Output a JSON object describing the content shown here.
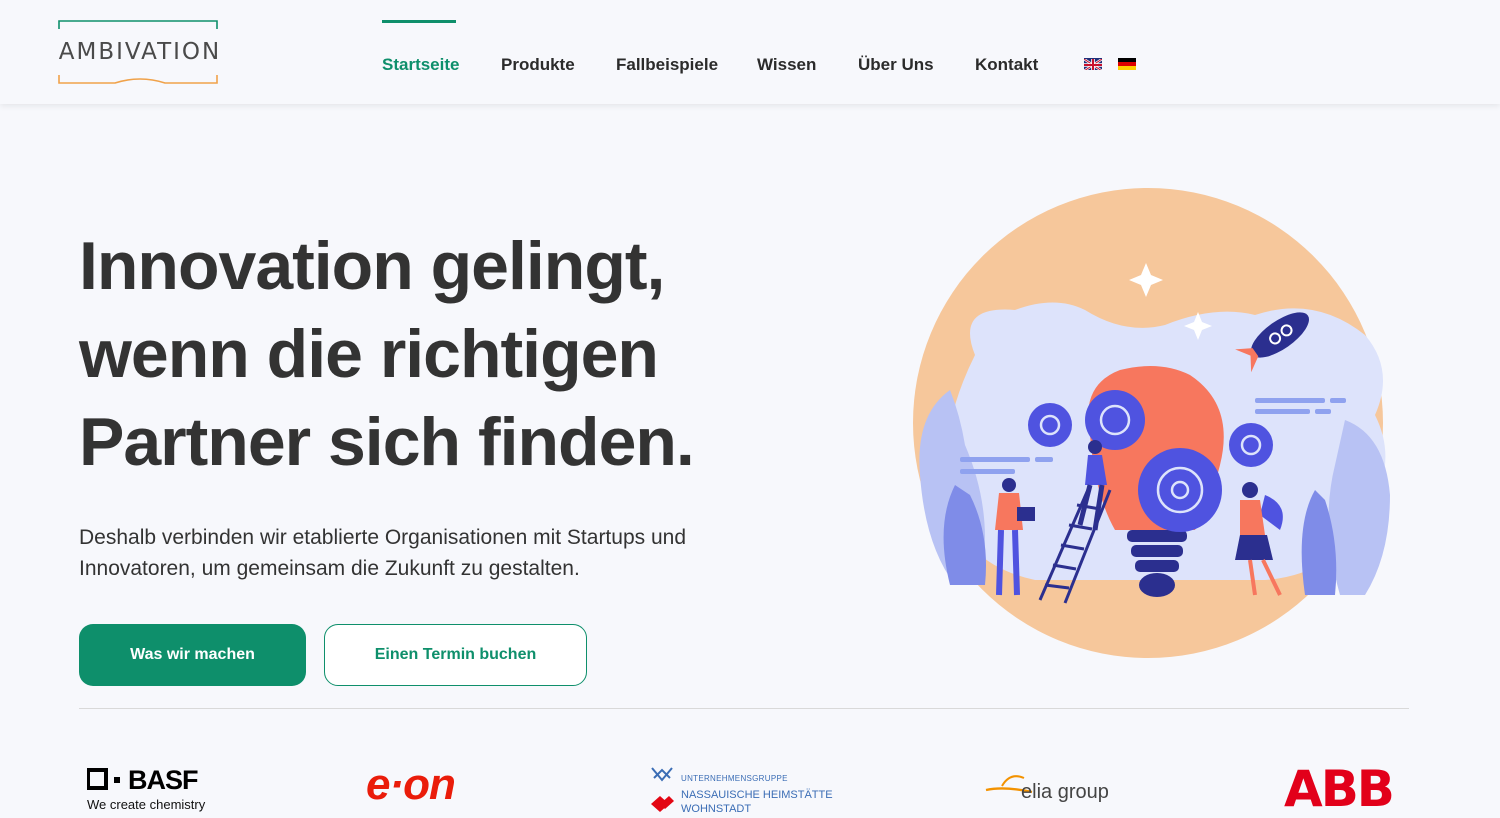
{
  "brand": {
    "logo_text": "AMBIVATION"
  },
  "nav": {
    "items": [
      {
        "label": "Startseite",
        "active": true
      },
      {
        "label": "Produkte",
        "active": false
      },
      {
        "label": "Fallbeispiele",
        "active": false
      },
      {
        "label": "Wissen",
        "active": false
      },
      {
        "label": "Über Uns",
        "active": false
      },
      {
        "label": "Kontakt",
        "active": false
      }
    ],
    "languages": [
      "en-flag-icon",
      "de-flag-icon"
    ]
  },
  "hero": {
    "title_lines": [
      "Innovation gelingt,",
      "wenn die richtigen",
      "Partner sich finden."
    ],
    "subtitle": "Deshalb verbinden wir etablierte Organisationen mit Startups und Innovatoren, um gemeinsam die Zukunft zu gestalten.",
    "primary_button": "Was wir machen",
    "secondary_button": "Einen Termin buchen"
  },
  "partners": {
    "basf_name": "BASF",
    "basf_tagline": "We create chemistry",
    "eon": "e·on",
    "nh_group": "UNTERNEHMENSGRUPPE",
    "nh_line1": "NASSAUISCHE HEIMSTÄTTE",
    "nh_line2": "WOHNSTADT",
    "elia": "elia group",
    "abb": "ABB"
  },
  "colors": {
    "accent": "#0e8f6b",
    "text": "#333333",
    "background": "#f7f8fc",
    "illustration_peach": "#f6c79b",
    "illustration_blue": "#5b5fe0",
    "illustration_coral": "#f7775e"
  }
}
